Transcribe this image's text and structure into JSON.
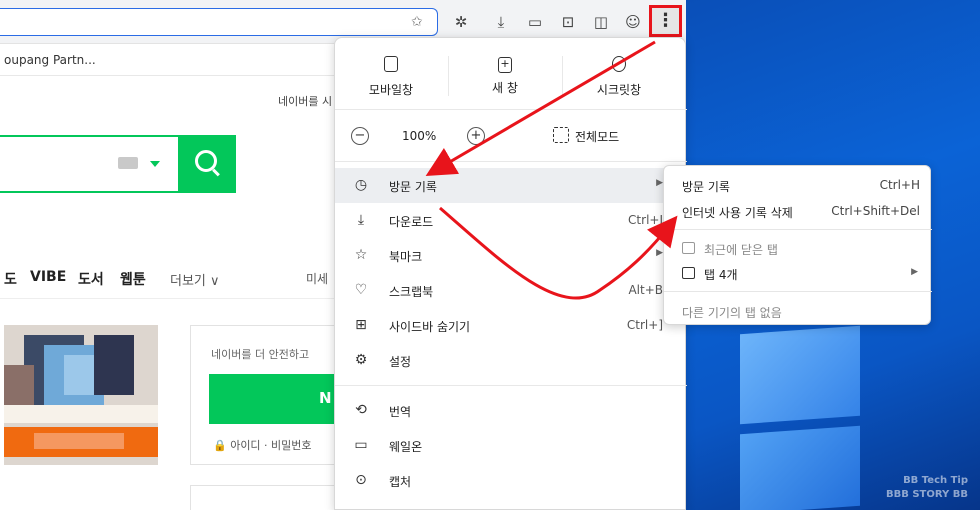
{
  "toolbar": {
    "icons": [
      "star-add-icon",
      "extensions-icon",
      "download-icon",
      "capture-icon",
      "screenshot-icon",
      "sidebar-icon",
      "profile-icon",
      "more-menu-icon"
    ]
  },
  "bookmarks": {
    "item": "oupang Partn..."
  },
  "page": {
    "top_text": "네이버를 시",
    "nav": [
      "도",
      "VIBE",
      "도서",
      "웹툰"
    ],
    "nav_more": "더보기 ∨",
    "nav_right": "미세",
    "login_text": "네이버를 더 안전하고",
    "login_btn": "N",
    "login_links": "🔒 아이디 · 비밀번호"
  },
  "menu": {
    "quick": [
      {
        "label": "모바일창",
        "icon": "mobile-window-icon"
      },
      {
        "label": "새 창",
        "icon": "new-window-icon"
      },
      {
        "label": "시크릿창",
        "icon": "secret-window-icon"
      }
    ],
    "zoom_minus": "−",
    "zoom_value": "100%",
    "zoom_plus": "+",
    "fullscreen": "전체모드",
    "items": [
      {
        "label": "방문 기록",
        "shortcut": "",
        "arrow": "▶",
        "icon": "history-icon",
        "glyph": "◷"
      },
      {
        "label": "다운로드",
        "shortcut": "Ctrl+J",
        "arrow": "",
        "icon": "download-icon",
        "glyph": "⤓"
      },
      {
        "label": "북마크",
        "shortcut": "",
        "arrow": "▶",
        "icon": "bookmark-star-icon",
        "glyph": "☆"
      },
      {
        "label": "스크랩북",
        "shortcut": "Alt+B",
        "arrow": "",
        "icon": "scrapbook-icon",
        "glyph": "♡"
      },
      {
        "label": "사이드바 숨기기",
        "shortcut": "Ctrl+]",
        "arrow": "",
        "icon": "sidebar-hide-icon",
        "glyph": "⊞"
      },
      {
        "label": "설정",
        "shortcut": "",
        "arrow": "",
        "icon": "settings-gear-icon",
        "glyph": "⚙"
      }
    ],
    "items2": [
      {
        "label": "번역",
        "icon": "translate-icon",
        "glyph": "⟲"
      },
      {
        "label": "웨일온",
        "icon": "whale-on-icon",
        "glyph": "▭"
      },
      {
        "label": "캡처",
        "icon": "capture-icon",
        "glyph": "⊙"
      }
    ]
  },
  "submenu": {
    "history": {
      "label": "방문 기록",
      "shortcut": "Ctrl+H"
    },
    "delete": {
      "label": "인터넷 사용 기록 삭제",
      "shortcut": "Ctrl+Shift+Del"
    },
    "recent": "최근에 닫은 탭",
    "tabs": "탭 4개",
    "tabs_arrow": "▶",
    "other": "다른 기기의 탭 없음"
  },
  "watermark": {
    "line1": "BB Tech Tip",
    "line2": "BBB STORY BB"
  },
  "colors": {
    "naver_green": "#03c75a",
    "highlight_red": "#e8141b",
    "desktop_blue": "#0b63d6"
  }
}
